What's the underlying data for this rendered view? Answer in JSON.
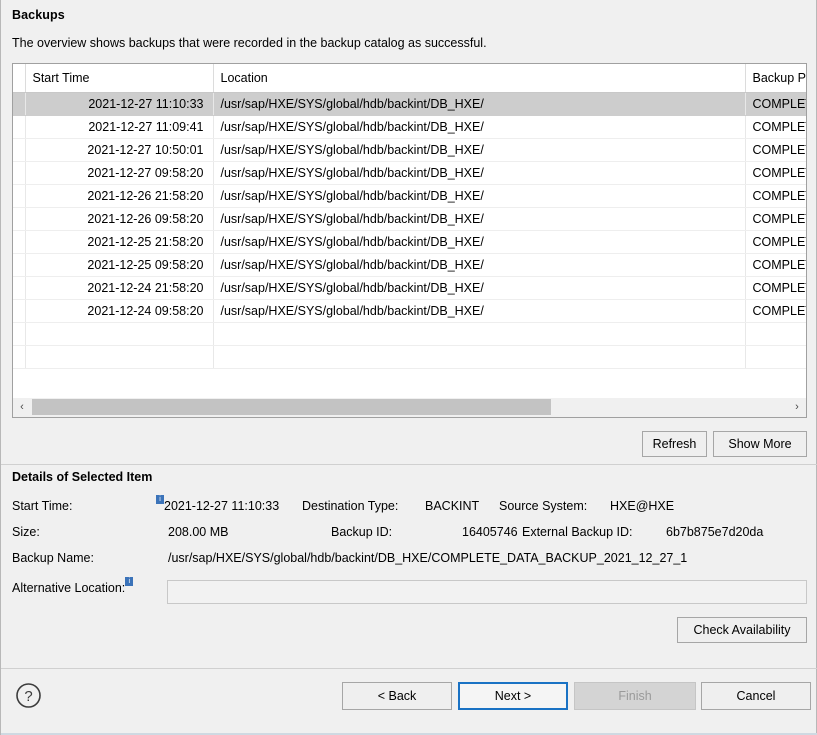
{
  "dialog": {
    "title": "Backups",
    "subtitle": "The overview shows backups that were recorded in the backup catalog as successful."
  },
  "table": {
    "columns": [
      "",
      "Start Time",
      "Location",
      "Backup Pr"
    ],
    "rows": [
      {
        "start_time": "2021-12-27 11:10:33",
        "location": "/usr/sap/HXE/SYS/global/hdb/backint/DB_HXE/",
        "backup_prefix": "COMPLET",
        "selected": true
      },
      {
        "start_time": "2021-12-27 11:09:41",
        "location": "/usr/sap/HXE/SYS/global/hdb/backint/DB_HXE/",
        "backup_prefix": "COMPLET",
        "selected": false
      },
      {
        "start_time": "2021-12-27 10:50:01",
        "location": "/usr/sap/HXE/SYS/global/hdb/backint/DB_HXE/",
        "backup_prefix": "COMPLET",
        "selected": false
      },
      {
        "start_time": "2021-12-27 09:58:20",
        "location": "/usr/sap/HXE/SYS/global/hdb/backint/DB_HXE/",
        "backup_prefix": "COMPLET",
        "selected": false
      },
      {
        "start_time": "2021-12-26 21:58:20",
        "location": "/usr/sap/HXE/SYS/global/hdb/backint/DB_HXE/",
        "backup_prefix": "COMPLET",
        "selected": false
      },
      {
        "start_time": "2021-12-26 09:58:20",
        "location": "/usr/sap/HXE/SYS/global/hdb/backint/DB_HXE/",
        "backup_prefix": "COMPLET",
        "selected": false
      },
      {
        "start_time": "2021-12-25 21:58:20",
        "location": "/usr/sap/HXE/SYS/global/hdb/backint/DB_HXE/",
        "backup_prefix": "COMPLET",
        "selected": false
      },
      {
        "start_time": "2021-12-25 09:58:20",
        "location": "/usr/sap/HXE/SYS/global/hdb/backint/DB_HXE/",
        "backup_prefix": "COMPLET",
        "selected": false
      },
      {
        "start_time": "2021-12-24 21:58:20",
        "location": "/usr/sap/HXE/SYS/global/hdb/backint/DB_HXE/",
        "backup_prefix": "COMPLET",
        "selected": false
      },
      {
        "start_time": "2021-12-24 09:58:20",
        "location": "/usr/sap/HXE/SYS/global/hdb/backint/DB_HXE/",
        "backup_prefix": "COMPLET",
        "selected": false
      }
    ],
    "empty_rows": 2
  },
  "scrollbar": {
    "left_arrow": "‹",
    "right_arrow": "›"
  },
  "table_actions": {
    "refresh_label": "Refresh",
    "show_more_label": "Show More"
  },
  "details": {
    "title": "Details of Selected Item",
    "start_time_label": "Start Time:",
    "start_time_value": "2021-12-27 11:10:33",
    "destination_type_label": "Destination Type:",
    "destination_type_value": "BACKINT",
    "source_system_label": "Source System:",
    "source_system_value": "HXE@HXE",
    "size_label": "Size:",
    "size_value": "208.00 MB",
    "backup_id_label": "Backup ID:",
    "backup_id_value": "16405746",
    "external_backup_id_label": "External Backup ID:",
    "external_backup_id_value": "6b7b875e7d20da",
    "backup_name_label": "Backup Name:",
    "backup_name_value": "/usr/sap/HXE/SYS/global/hdb/backint/DB_HXE/COMPLETE_DATA_BACKUP_2021_12_27_1",
    "alternative_location_label": "Alternative Location:",
    "alternative_location_value": "",
    "info_decorator": "i",
    "check_availability_label": "Check Availability"
  },
  "footer": {
    "help_icon": "?",
    "back_label": "< Back",
    "next_label": "Next >",
    "finish_label": "Finish",
    "cancel_label": "Cancel"
  },
  "colors": {
    "accent": "#1a72c4",
    "selection": "#cdcdcd",
    "background": "#f0f0f0",
    "info_badge": "#3b73b9"
  }
}
